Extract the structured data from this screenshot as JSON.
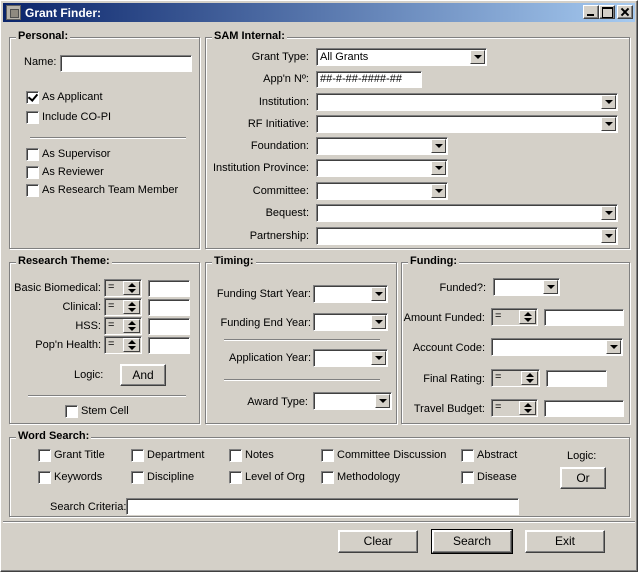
{
  "window": {
    "title": "Grant Finder:"
  },
  "personal": {
    "label": "Personal:",
    "name_label": "Name:",
    "name_value": "",
    "as_applicant": "As Applicant",
    "include_copi": "Include CO-PI",
    "as_supervisor": "As Supervisor",
    "as_reviewer": "As Reviewer",
    "as_research_team": "As Research Team Member"
  },
  "sam": {
    "label": "SAM Internal:",
    "grant_type_label": "Grant Type:",
    "grant_type_value": "All Grants",
    "appn_label": "App'n Nº:",
    "appn_value": "##-#-##-####-##",
    "institution_label": "Institution:",
    "rf_initiative_label": "RF Initiative:",
    "foundation_label": "Foundation:",
    "institution_province_label": "Institution Province:",
    "committee_label": "Committee:",
    "bequest_label": "Bequest:",
    "partnership_label": "Partnership:"
  },
  "research": {
    "label": "Research Theme:",
    "basic_biomedical": "Basic Biomedical:",
    "clinical": "Clinical:",
    "hss": "HSS:",
    "popn_health": "Pop'n Health:",
    "operator": "=",
    "logic_label": "Logic:",
    "logic_button": "And",
    "stem_cell": "Stem Cell"
  },
  "timing": {
    "label": "Timing:",
    "funding_start_year": "Funding Start Year:",
    "funding_end_year": "Funding End Year:",
    "application_year": "Application Year:",
    "award_type": "Award Type:"
  },
  "funding": {
    "label": "Funding:",
    "funded": "Funded?:",
    "amount_funded": "Amount Funded:",
    "account_code": "Account Code:",
    "final_rating": "Final Rating:",
    "travel_budget": "Travel Budget:",
    "operator": "="
  },
  "word_search": {
    "label": "Word Search:",
    "grant_title": "Grant Title",
    "department": "Department",
    "notes": "Notes",
    "committee_discussion": "Committee Discussion",
    "abstract": "Abstract",
    "keywords": "Keywords",
    "discipline": "Discipline",
    "level_of_org": "Level of Org",
    "methodology": "Methodology",
    "disease": "Disease",
    "logic_label": "Logic:",
    "logic_button": "Or",
    "search_criteria_label": "Search Criteria:",
    "search_criteria_value": ""
  },
  "footer": {
    "clear": "Clear",
    "search": "Search",
    "exit": "Exit"
  }
}
